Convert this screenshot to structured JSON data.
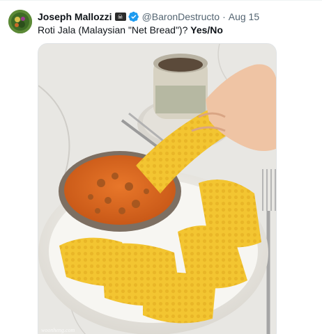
{
  "tweet": {
    "author": {
      "display_name": "Joseph Mallozzi",
      "flag_icon": "pirate-flag-icon",
      "verified_icon": "verified-badge-icon",
      "handle": "@BaronDestructo",
      "separator": "·",
      "date": "Aug 15"
    },
    "text_main": "Roti Jala (Malaysian \"Net Bread\")? ",
    "text_bold": "Yes/No",
    "media": {
      "description_icon": "food-photo",
      "watermark": "woonheng.com"
    }
  },
  "colors": {
    "text_primary": "#0f1419",
    "text_secondary": "#536471",
    "verified_blue": "#1d9bf0",
    "curry": "#d9661f",
    "roti": "#f2c230"
  }
}
